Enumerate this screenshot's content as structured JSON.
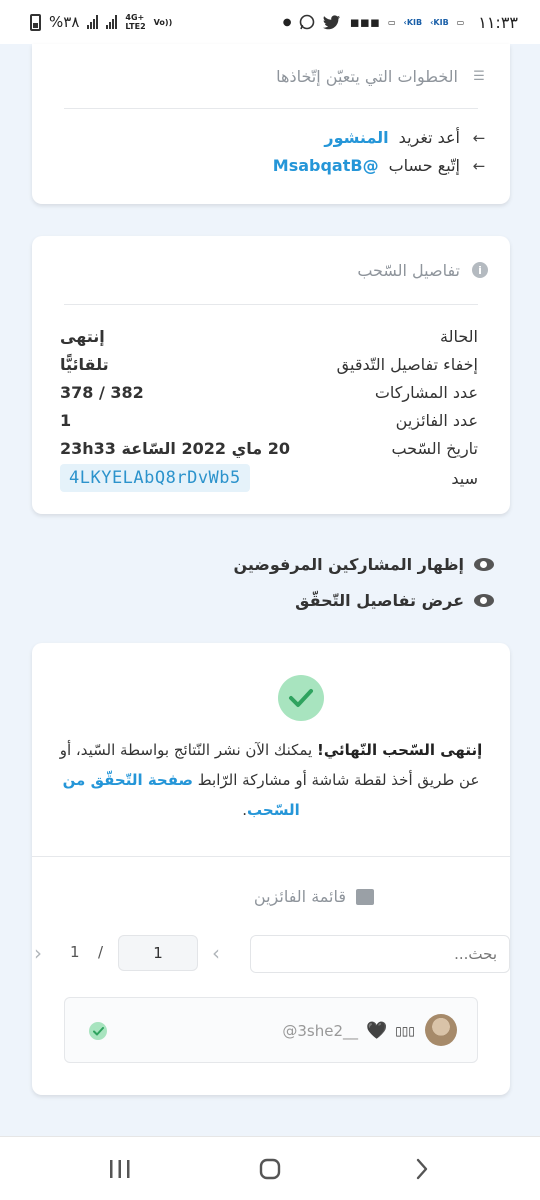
{
  "status_bar": {
    "time": "١١:٣٣",
    "battery_percent": "%٣٨",
    "network_line1": "4G+",
    "network_line2": "LTE2",
    "volte_line1": "Vo))",
    "icons": [
      "battery-icon",
      "signal-icon",
      "whatsapp-icon",
      "twitter-icon",
      "voicemail-icon",
      "kib-icon",
      "kib-icon",
      "kib-icon",
      "dot-icon"
    ]
  },
  "steps_card": {
    "title": "الخطوات التي يتعيّن إتّخاذها",
    "retweet_text": "أعد تغريد",
    "retweet_link": "المنشور",
    "follow_text": "إتّبع حساب",
    "follow_link": "@MsabqatB"
  },
  "details_card": {
    "title": "تفاصيل السّحب",
    "rows": [
      {
        "label": "الحالة",
        "value": "إنتهى"
      },
      {
        "label": "إخفاء تفاصيل التّدقيق",
        "value": "تلقائيًّا"
      },
      {
        "label": "عدد المشاركات",
        "value": "378 / 382"
      },
      {
        "label": "عدد الفائزين",
        "value": "1"
      },
      {
        "label": "تاريخ السّحب",
        "value": "20 ماي 2022 السّاعة 23h33"
      },
      {
        "label": "سيد",
        "value": "4LKYELAbQ8rDvWb5"
      }
    ]
  },
  "toggles": {
    "show_rejected": "إظهار المشاركين المرفوضين",
    "show_verification": "عرض تفاصيل التّحقّق"
  },
  "result_card": {
    "msg_bold": "إنتهى السّحب النّهائي!",
    "msg_text": " يمكنك الآن نشر النّتائج بواسطة السّيد، أو عن طريق أخذ لقطة شاشة أو مشاركة الرّابط ",
    "msg_link": "صفحة التّحقّق من السّحب",
    "msg_end": ".",
    "winners_title": "قائمة الفائزين",
    "search_placeholder": "بحث...",
    "page_current": "1",
    "page_separator": "/",
    "page_total": "1",
    "winner": {
      "handle": "@3she2__",
      "heart": "🖤",
      "extra": "▯▯▯"
    }
  },
  "colors": {
    "accent": "#2596d8",
    "success": "#2fa35f",
    "success_bg": "#a8e4bf",
    "page_bg": "#eef4fb"
  }
}
